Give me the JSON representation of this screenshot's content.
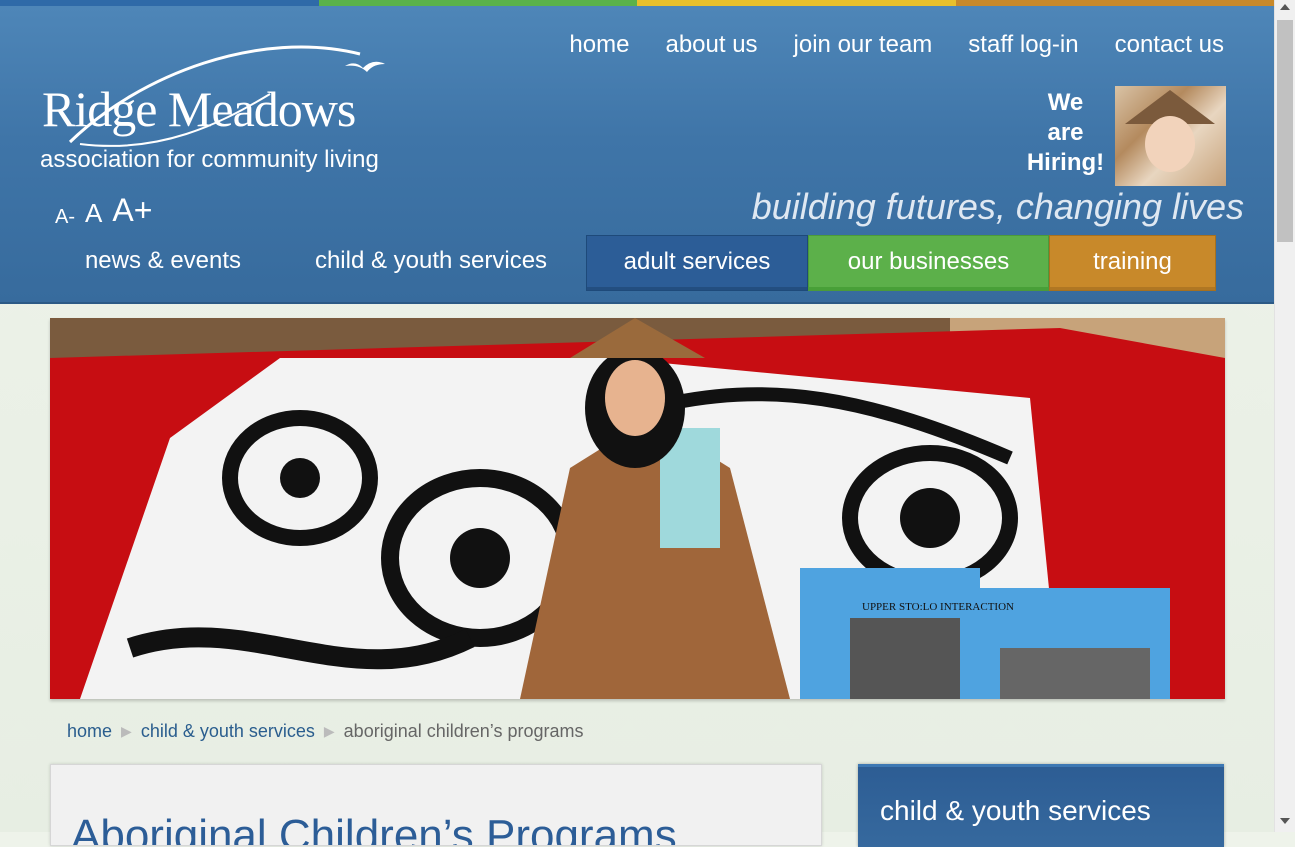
{
  "colors": {
    "bar": [
      "#2f6aa8",
      "#5ab24a",
      "#e8c02c",
      "#c8892a"
    ],
    "adult": "#2c5d97",
    "businesses": "#5cb04a",
    "training": "#c8892a"
  },
  "logo": {
    "name": "Ridge Meadows",
    "subtitle": "association for community living"
  },
  "topnav": [
    "home",
    "about us",
    "join our team",
    "staff log-in",
    "contact us"
  ],
  "hiring": {
    "line1": "We",
    "line2": "are",
    "line3": "Hiring!"
  },
  "fontsize": {
    "small": "A-",
    "medium": "A",
    "large": "A+"
  },
  "tagline": "building futures, changing lives",
  "mainnav": [
    "news & events",
    "child & youth services",
    "adult services",
    "our businesses",
    "training"
  ],
  "hero": {
    "book_text": "UPPER STO:LO INTERACTION"
  },
  "breadcrumb": {
    "home": "home",
    "parent": "child & youth services",
    "current": "aboriginal children’s programs"
  },
  "page_title": "Aboriginal Children’s Programs",
  "sidebar": {
    "title": "child & youth services"
  }
}
